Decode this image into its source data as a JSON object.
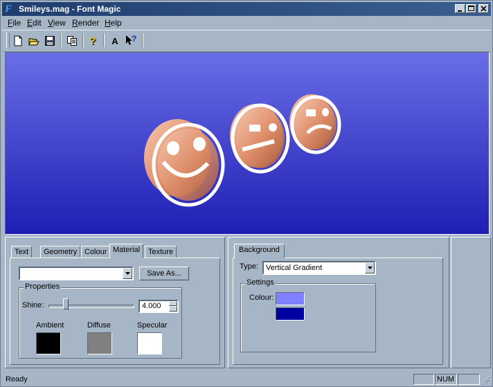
{
  "window": {
    "title": "Smileys.mag - Font Magic",
    "app_icon_letter": "F"
  },
  "caption_buttons": {
    "minimize": "_",
    "maximize": "□",
    "close": "×"
  },
  "menu": [
    {
      "label": "File",
      "accel": "F",
      "rest": "ile"
    },
    {
      "label": "Edit",
      "accel": "E",
      "rest": "dit"
    },
    {
      "label": "View",
      "accel": "V",
      "rest": "iew"
    },
    {
      "label": "Render",
      "accel": "R",
      "rest": "ender"
    },
    {
      "label": "Help",
      "accel": "H",
      "rest": "elp"
    }
  ],
  "toolbar": {
    "icons": [
      "new-file-icon",
      "open-folder-icon",
      "save-disk-icon",
      "copy-icon",
      "help-icon",
      "text-icon",
      "context-help-icon"
    ],
    "help_glyph": "?",
    "text_glyph": "A",
    "context_help_glyph": "?"
  },
  "viewport": {
    "gradient_top": "#6a6ee6",
    "gradient_bottom": "#1e1eb4",
    "smiley_color": "#e89a78",
    "faces": [
      "smile",
      "neutral",
      "frown"
    ]
  },
  "left_panel": {
    "tabs": [
      "Text",
      "Geometry",
      "Colour",
      "Material",
      "Texture"
    ],
    "active_tab": "Material",
    "material_select_value": "",
    "save_as_label": "Save As...",
    "properties_label": "Properties",
    "shine_label": "Shine:",
    "shine_value": "4.000",
    "shine_slider_fraction": 0.18,
    "ambient_label": "Ambient",
    "diffuse_label": "Diffuse",
    "specular_label": "Specular",
    "ambient_color": "#000000",
    "diffuse_color": "#808080",
    "specular_color": "#ffffff"
  },
  "right_panel": {
    "tabs": [
      "Background"
    ],
    "type_label": "Type:",
    "type_value": "Vertical Gradient",
    "settings_label": "Settings",
    "colour_label": "Colour:",
    "colour_top": "#8080ff",
    "colour_bottom": "#0000a0"
  },
  "status": {
    "text": "Ready",
    "num": "NUM"
  }
}
